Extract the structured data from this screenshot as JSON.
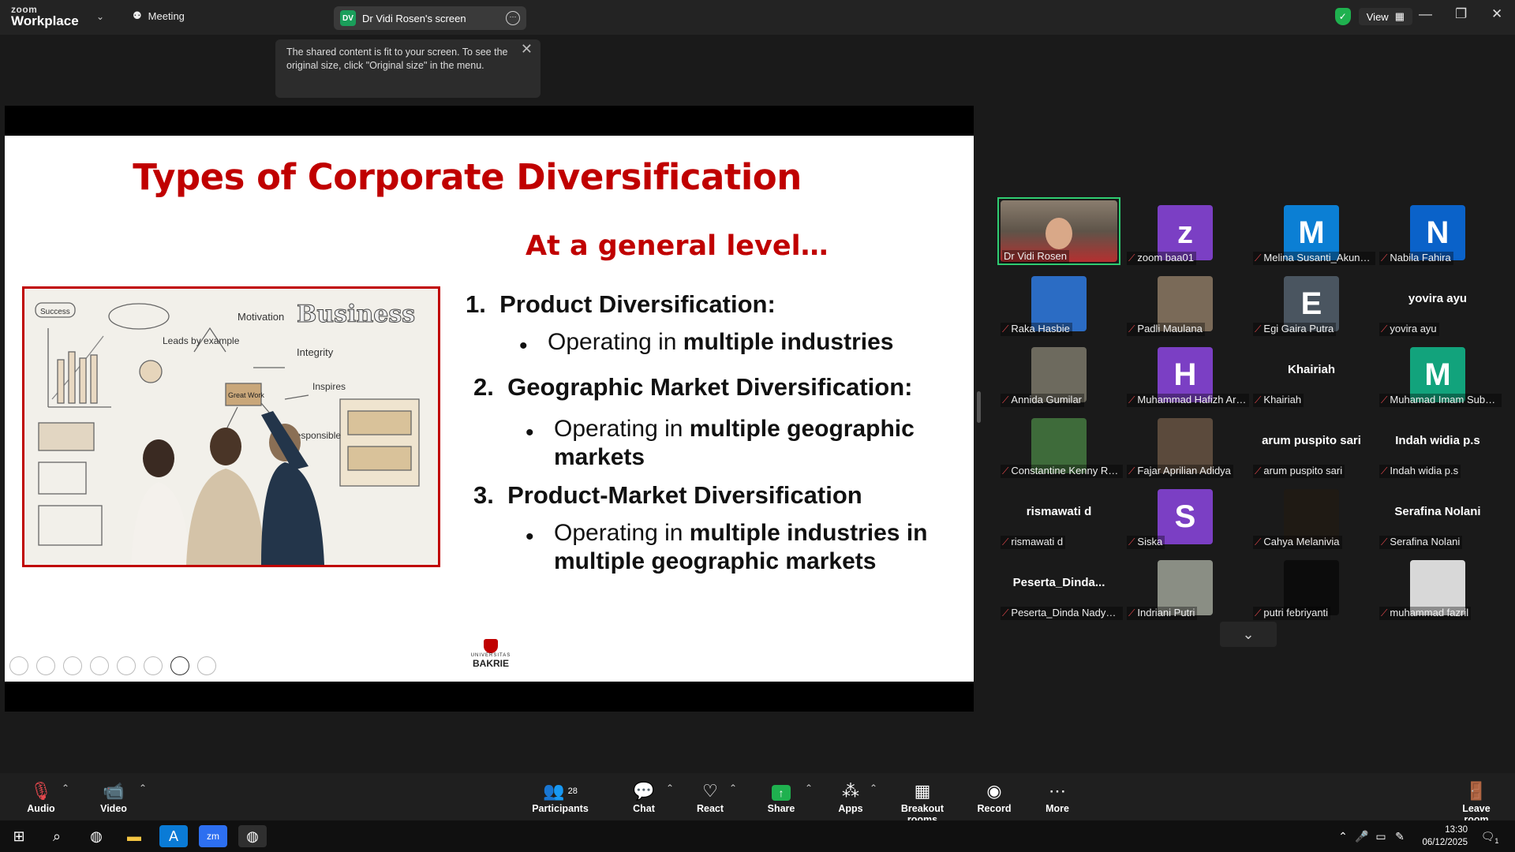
{
  "titlebar": {
    "brand_small": "zoom",
    "brand_large": "Workplace",
    "meeting_tab": "Meeting",
    "share_tab_initials": "DV",
    "share_tab_label": "Dr Vidi Rosen's screen",
    "view_label": "View"
  },
  "tooltip": {
    "text": "The shared content is fit to your screen. To see the original size, click \"Original size\" in the menu."
  },
  "slide": {
    "title": "Types of Corporate Diversification",
    "subtitle": "At a general level…",
    "items": [
      {
        "number": "1.",
        "heading": "Product Diversification:",
        "bullet_plain": "Operating in ",
        "bullet_bold": "multiple industries"
      },
      {
        "number": "2.",
        "heading": "Geographic Market Diversification:",
        "bullet_plain": "Operating in ",
        "bullet_bold": "multiple geographic markets"
      },
      {
        "number": "3.",
        "heading": "Product-Market Diversification",
        "bullet_plain": "Operating in ",
        "bullet_bold": "multiple industries in multiple geographic markets"
      }
    ],
    "logo_line1": "UNIVERSITAS",
    "logo_line2": "BAKRIE",
    "image_text": {
      "success": "Success",
      "business": "Business",
      "motivation": "Motivation",
      "integrity": "Integrity",
      "leads": "Leads by example",
      "great_work": "Great Work",
      "responsible": "Responsible",
      "inspires": "Inspires"
    }
  },
  "participants_panel": [
    {
      "name": "Dr Vidi Rosen",
      "avatar_type": "video",
      "active": true,
      "muted": false
    },
    {
      "name": "zoom baa01",
      "avatar_type": "letter",
      "letter": "z",
      "color": "#7b3fc4",
      "muted": true
    },
    {
      "name": "Melina Susanti_Akuntansi",
      "avatar_type": "letter",
      "letter": "M",
      "color": "#0b7fd4",
      "muted": true
    },
    {
      "name": "Nabila Fahira",
      "avatar_type": "letter",
      "letter": "N",
      "color": "#0a62c9",
      "muted": true
    },
    {
      "name": "Raka Hasbie",
      "avatar_type": "photo",
      "color": "#2b6cc4",
      "muted": true
    },
    {
      "name": "Padli Maulana",
      "avatar_type": "photo",
      "color": "#7a6a58",
      "muted": true
    },
    {
      "name": "Egi Gaira Putra",
      "avatar_type": "letter",
      "letter": "E",
      "color": "#4a5560",
      "muted": true
    },
    {
      "name": "yovira ayu",
      "avatar_type": "name",
      "big_name": "yovira ayu",
      "muted": true
    },
    {
      "name": "Annida Gumilar",
      "avatar_type": "photo",
      "color": "#6d6a5e",
      "muted": true
    },
    {
      "name": "Muhammad Hafizh Arrahman",
      "avatar_type": "letter",
      "letter": "H",
      "color": "#7b3fc4",
      "muted": true
    },
    {
      "name": "Khairiah",
      "avatar_type": "name",
      "big_name": "Khairiah",
      "muted": true
    },
    {
      "name": "Muhamad Imam Subagja",
      "avatar_type": "letter",
      "letter": "M",
      "color": "#12a37c",
      "muted": true
    },
    {
      "name": "Constantine Kenny Rizky",
      "avatar_type": "photo",
      "color": "#3e6b3a",
      "muted": true
    },
    {
      "name": "Fajar Aprilian Adidya",
      "avatar_type": "photo",
      "color": "#5b4a3c",
      "muted": true
    },
    {
      "name": "arum puspito sari",
      "avatar_type": "name",
      "big_name": "arum puspito sari",
      "muted": true
    },
    {
      "name": "Indah widia p.s",
      "avatar_type": "name",
      "big_name": "Indah widia p.s",
      "muted": true
    },
    {
      "name": "rismawati d",
      "avatar_type": "name",
      "big_name": "rismawati d",
      "muted": true
    },
    {
      "name": "Siska",
      "avatar_type": "letter",
      "letter": "S",
      "color": "#7b3fc4",
      "muted": true
    },
    {
      "name": "Cahya Melanivia",
      "avatar_type": "photo",
      "color": "#1f1a14",
      "muted": true
    },
    {
      "name": "Serafina Nolani",
      "avatar_type": "name",
      "big_name": "Serafina Nolani",
      "muted": true
    },
    {
      "name": "Peserta_Dinda Nadya Putri",
      "avatar_type": "name",
      "big_name": "Peserta_Dinda...",
      "muted": true
    },
    {
      "name": "Indriani Putri",
      "avatar_type": "photo",
      "color": "#8a8e84",
      "muted": true
    },
    {
      "name": "putri febriyanti",
      "avatar_type": "photo",
      "color": "#0c0c0c",
      "muted": true
    },
    {
      "name": "muhammad fazril",
      "avatar_type": "photo",
      "color": "#d8d8d8",
      "muted": true
    }
  ],
  "toolbar": {
    "audio": "Audio",
    "video": "Video",
    "participants": "Participants",
    "participants_count": "28",
    "chat": "Chat",
    "react": "React",
    "share": "Share",
    "apps": "Apps",
    "breakout": "Breakout rooms",
    "record": "Record",
    "more": "More",
    "leave": "Leave room"
  },
  "taskbar": {
    "time": "13:30",
    "date": "06/12/2025",
    "notif_count": "1"
  },
  "colors": {
    "accent_red": "#c00000",
    "active_border": "#2ecc71",
    "share_green": "#1fb14f"
  }
}
